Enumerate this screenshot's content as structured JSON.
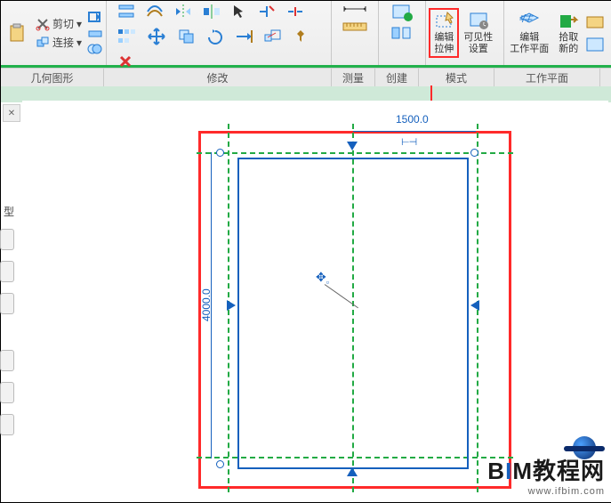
{
  "ribbon": {
    "cut": "剪切",
    "join": "连接",
    "edit_extrude": "编辑\n拉伸",
    "visibility": "可见性\n设置",
    "edit_wp": "编辑\n工作平面",
    "pick_new": "拾取\n新的",
    "groups": {
      "geometry": "几何图形",
      "modify": "修改",
      "measure": "测量",
      "create": "创建",
      "mode": "模式",
      "workplane": "工作平面"
    }
  },
  "canvas": {
    "dim_w": "1500.0",
    "dim_h": "4000.0",
    "type_label": "型",
    "dim_symbol": "⟶"
  },
  "logo": {
    "main": "BIM教程网",
    "sub": "www.ifbim.com"
  }
}
